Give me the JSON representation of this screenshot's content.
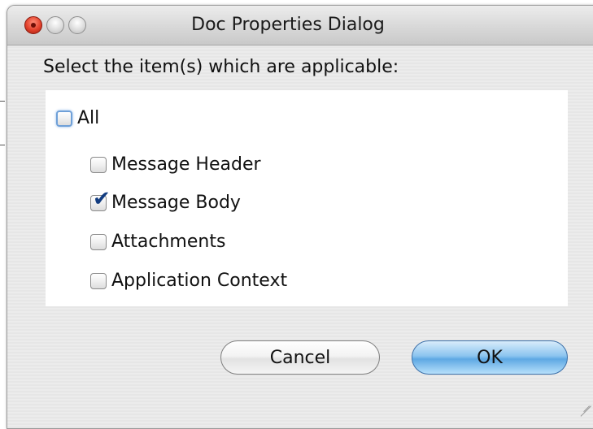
{
  "window": {
    "title": "Doc Properties Dialog"
  },
  "dialog": {
    "prompt": "Select the item(s) which are applicable:",
    "all_option": {
      "label": "All",
      "checked": false
    },
    "options": [
      {
        "label": "Message Header",
        "checked": false
      },
      {
        "label": "Message Body",
        "checked": true
      },
      {
        "label": "Attachments",
        "checked": false
      },
      {
        "label": "Application Context",
        "checked": false
      }
    ],
    "check_glyph": "✔"
  },
  "buttons": {
    "cancel_label": "Cancel",
    "ok_label": "OK"
  },
  "colors": {
    "close_button": "#e3412b",
    "default_button": "#5ea8e3",
    "check_mark": "#123c80"
  }
}
